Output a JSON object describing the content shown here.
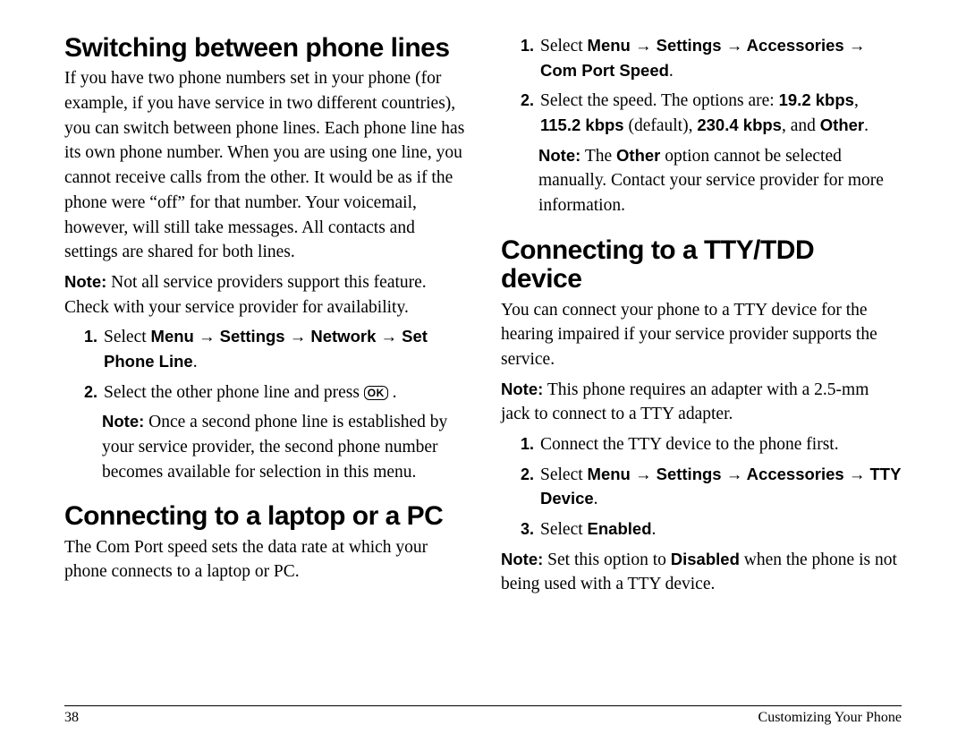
{
  "footer": {
    "page_number": "38",
    "section": "Customizing Your Phone"
  },
  "left": {
    "h1": "Switching between phone lines",
    "p1": "If you have two phone numbers set in your phone (for example, if you have service in two different countries), you can switch between phone lines. Each phone line has its own phone number. When you are using one line, you cannot receive calls from the other. It would be as if the phone were “off” for that number. Your voicemail, however, will still take messages. All contacts and settings are shared for both lines.",
    "note1_label": "Note:",
    "note1": "Not all service providers support this feature. Check with your service provider for availability.",
    "step1_prefix": "Select ",
    "step1_path": "Menu → Settings → Network → Set Phone Line",
    "step1_suffix": ".",
    "step2": "Select the other phone line and press ",
    "ok_label": "OK",
    "step2_suffix": " .",
    "note2_label": "Note:",
    "note2": "Once a second phone line is established by your service provider, the second phone number becomes available for selection in this menu.",
    "h2": "Connecting to a laptop or a PC",
    "p2": "The Com Port speed sets the data rate at which your phone connects to a laptop or PC."
  },
  "right": {
    "step1_prefix": "Select ",
    "step1_path": "Menu → Settings → Accessories → Com Port Speed",
    "step1_suffix": ".",
    "step2_a": "Select the speed. The options are: ",
    "s19": "19.2 kbps",
    "step2_b": ", ",
    "s115": "115.2 kbps",
    "step2_c": " (default), ",
    "s230": "230.4 kbps",
    "step2_d": ", and ",
    "sOther": "Other",
    "step2_e": ".",
    "noteA_label": "Note:",
    "noteA_a": "The ",
    "noteA_other": "Other",
    "noteA_b": " option cannot be selected manually. Contact your service provider for more information.",
    "h1": "Connecting to a TTY/TDD device",
    "p1": "You can connect your phone to a TTY device for the hearing impaired if your service provider supports the service.",
    "noteB_label": "Note:",
    "noteB": "This phone requires an adapter with a 2.5-mm jack to connect to a TTY adapter.",
    "tty_step1": "Connect the TTY device to the phone first.",
    "tty_step2_prefix": "Select ",
    "tty_step2_path": "Menu → Settings → Accessories → TTY Device",
    "tty_step2_suffix": ".",
    "tty_step3_prefix": "Select ",
    "tty_step3_enabled": "Enabled",
    "tty_step3_suffix": ".",
    "noteC_label": "Note:",
    "noteC_a": "Set this option to ",
    "noteC_disabled": "Disabled",
    "noteC_b": " when the phone is not being used with a TTY device."
  }
}
